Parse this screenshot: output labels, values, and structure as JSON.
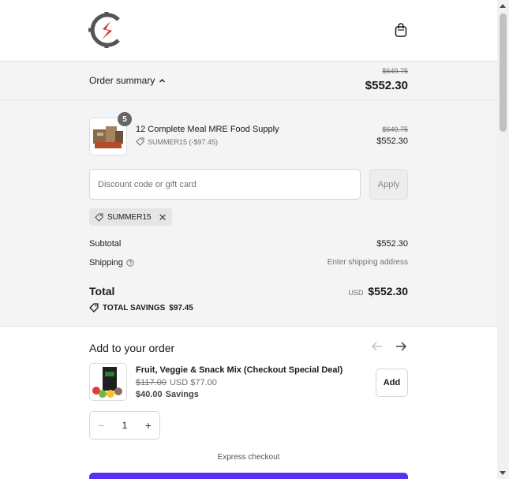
{
  "colors": {
    "accent": "#5a31f4",
    "logo_red": "#d92a2a",
    "logo_gray": "#555555",
    "summary_bg": "#f4f4f4"
  },
  "header": {
    "logo_icon": "brand-logo",
    "cart_icon": "shopping-bag-icon"
  },
  "summary": {
    "toggle_label": "Order summary",
    "toggle_icon": "chevron-up-icon",
    "original_total": "$649.75",
    "total": "$552.30"
  },
  "line_item": {
    "quantity": "5",
    "name": "12 Complete Meal MRE Food Supply",
    "discount_text": "SUMMER15 (-$97.45)",
    "original_price": "$649.75",
    "price": "$552.30"
  },
  "discount": {
    "placeholder": "Discount code or gift card",
    "apply_label": "Apply",
    "applied_code": "SUMMER15"
  },
  "totals": {
    "subtotal_label": "Subtotal",
    "subtotal_value": "$552.30",
    "shipping_label": "Shipping",
    "shipping_value": "Enter shipping address",
    "total_label": "Total",
    "currency": "USD",
    "total_value": "$552.30",
    "savings_label": "TOTAL SAVINGS",
    "savings_value": "$97.45"
  },
  "upsell": {
    "title": "Add to your order",
    "name": "Fruit, Veggie & Snack Mix (Checkout Special Deal)",
    "original_price": "$117.00",
    "price": "USD $77.00",
    "savings_amount": "$40.00",
    "savings_label": "Savings",
    "add_label": "Add",
    "quantity": "1",
    "minus": "−",
    "plus": "+"
  },
  "express": {
    "label": "Express checkout"
  }
}
